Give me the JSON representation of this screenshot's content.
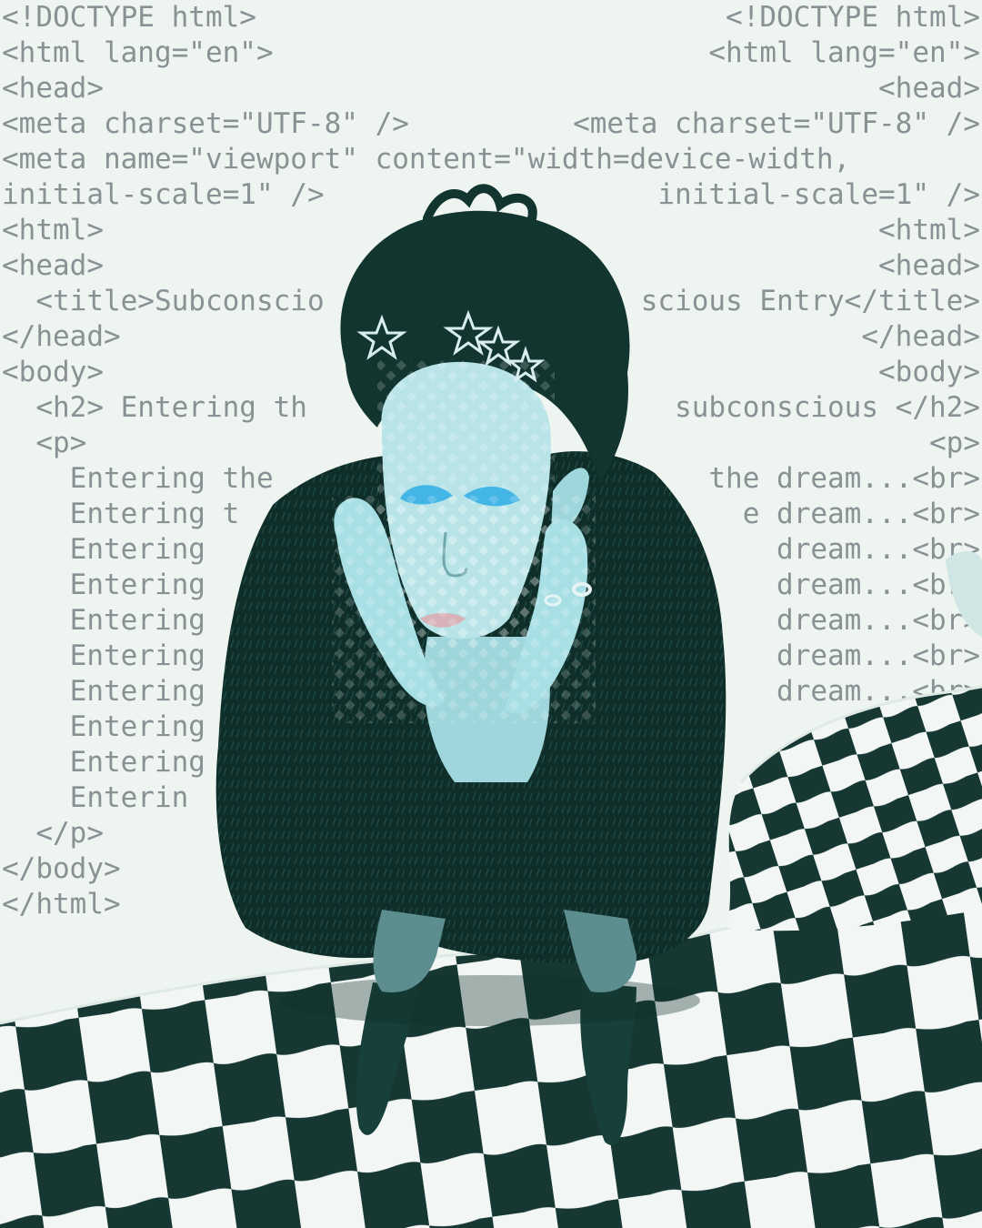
{
  "code_left": [
    "<!DOCTYPE html>",
    "<html lang=\"en\">",
    "<head>",
    "<meta charset=\"UTF-8\" />",
    "<meta name=\"viewport\" content=\"width=device-width,",
    "initial-scale=1\" />",
    "<html>",
    "<head>",
    "  <title>Subconscio",
    "</head>",
    "<body>",
    "  <h2> Entering th",
    "  <p>",
    "    Entering the",
    "    Entering t",
    "    Entering",
    "    Entering",
    "    Entering",
    "    Entering",
    "    Entering",
    "    Entering",
    "    Entering",
    "    Enterin",
    "  </p>",
    "</body>",
    "</html>"
  ],
  "code_right": [
    "<!DOCTYPE html>",
    "<html lang=\"en\">",
    "<head>",
    "<meta charset=\"UTF-8\" />",
    "",
    "initial-scale=1\" />",
    "<html>",
    "<head>",
    "scious Entry</title>",
    "</head>",
    "<body>",
    "subconscious </h2>",
    "<p>",
    "the dream...<br>",
    "e dream...<br>",
    "dream...<br>",
    "dream...<br>",
    "dream...<br>",
    "dream...<br>",
    "dream...<br>",
    "dream",
    ""
  ],
  "colors": {
    "background": "#eef4ef",
    "code_text": "#8a9195",
    "fur_coat": "#0f2d29",
    "skin_tint": "#b8e4e8",
    "eyeshadow": "#43b6e6",
    "checker_dark": "#173832",
    "checker_light": "#f2f7f5"
  },
  "icons": [
    "star-hair-clip-icon",
    "ring-icon"
  ]
}
